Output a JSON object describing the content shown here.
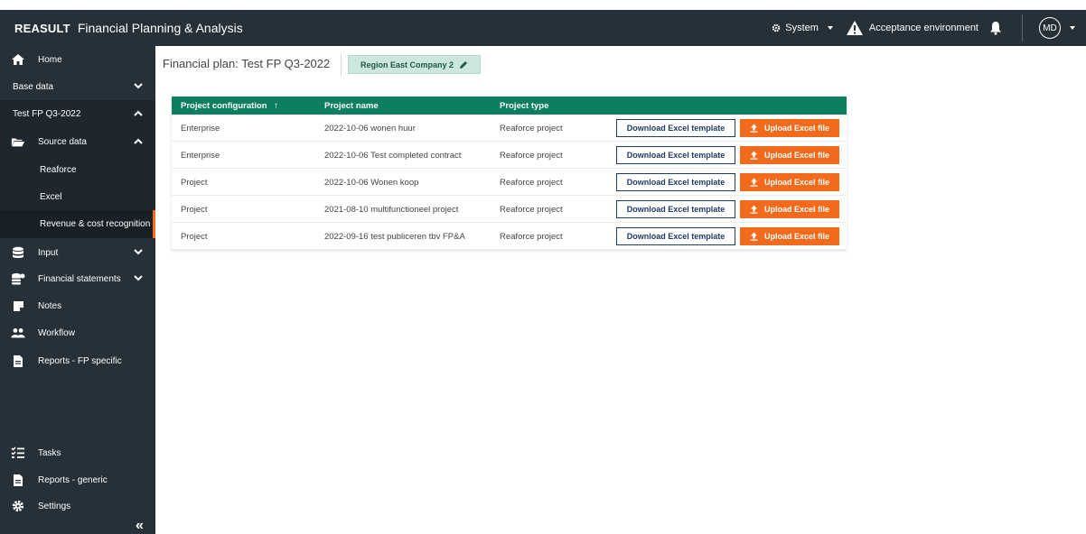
{
  "header": {
    "logo": "REASULT",
    "app_name": "Financial Planning & Analysis",
    "system_label": "System",
    "environment_label": "Acceptance environment",
    "user_initials": "MD"
  },
  "sidebar": {
    "home": "Home",
    "base_data": "Base data",
    "plan": "Test FP Q3-2022",
    "source_data": "Source data",
    "reaforce": "Reaforce",
    "excel": "Excel",
    "revenue": "Revenue & cost recognition",
    "input": "Input",
    "financial_statements": "Financial statements",
    "notes": "Notes",
    "workflow": "Workflow",
    "reports_fp": "Reports - FP specific",
    "tasks": "Tasks",
    "reports_generic": "Reports - generic",
    "settings": "Settings",
    "collapse": "«"
  },
  "main": {
    "plan_title": "Financial plan: Test FP Q3-2022",
    "region": "Region East Company 2",
    "columns": {
      "config": "Project configuration",
      "sort_indicator": "↑",
      "name": "Project name",
      "type": "Project type"
    },
    "download_label": "Download Excel template",
    "upload_label": "Upload Excel file",
    "rows": [
      {
        "config": "Enterprise",
        "name": "2022-10-06 wonen huur",
        "type": "Reaforce project"
      },
      {
        "config": "Enterprise",
        "name": "2022-10-06 Test completed contract",
        "type": "Reaforce project"
      },
      {
        "config": "Project",
        "name": "2022-10-06 Wonen koop",
        "type": "Reaforce project"
      },
      {
        "config": "Project",
        "name": "2021-08-10 multifunctioneel project",
        "type": "Reaforce project"
      },
      {
        "config": "Project",
        "name": "2022-09-16 test publiceren tbv FP&A",
        "type": "Reaforce project"
      }
    ]
  },
  "colors": {
    "topbar": "#253038",
    "table_header": "#0b7f5f",
    "accent_orange": "#f26a1b",
    "button_border": "#1f3b63"
  }
}
